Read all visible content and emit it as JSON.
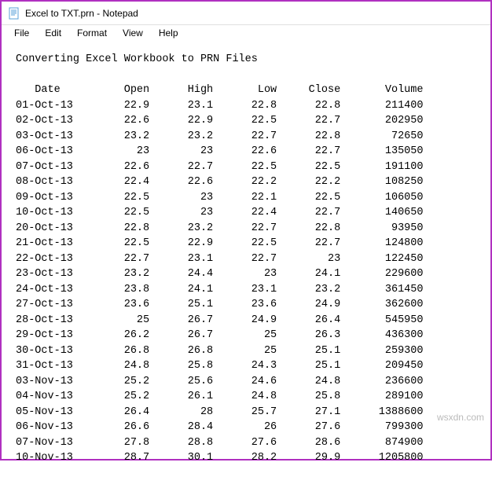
{
  "window": {
    "title": "Excel to TXT.prn - Notepad"
  },
  "menubar": {
    "items": [
      "File",
      "Edit",
      "Format",
      "View",
      "Help"
    ]
  },
  "document": {
    "heading": "Converting Excel Workbook to PRN Files",
    "columns": [
      "Date",
      "Open",
      "High",
      "Low",
      "Close",
      "Volume"
    ],
    "rows": [
      {
        "date": "01-Oct-13",
        "open": "22.9",
        "high": "23.1",
        "low": "22.8",
        "close": "22.8",
        "volume": "211400"
      },
      {
        "date": "02-Oct-13",
        "open": "22.6",
        "high": "22.9",
        "low": "22.5",
        "close": "22.7",
        "volume": "202950"
      },
      {
        "date": "03-Oct-13",
        "open": "23.2",
        "high": "23.2",
        "low": "22.7",
        "close": "22.8",
        "volume": "72650"
      },
      {
        "date": "06-Oct-13",
        "open": "23",
        "high": "23",
        "low": "22.6",
        "close": "22.7",
        "volume": "135050"
      },
      {
        "date": "07-Oct-13",
        "open": "22.6",
        "high": "22.7",
        "low": "22.5",
        "close": "22.5",
        "volume": "191100"
      },
      {
        "date": "08-Oct-13",
        "open": "22.4",
        "high": "22.6",
        "low": "22.2",
        "close": "22.2",
        "volume": "108250"
      },
      {
        "date": "09-Oct-13",
        "open": "22.5",
        "high": "23",
        "low": "22.1",
        "close": "22.5",
        "volume": "106050"
      },
      {
        "date": "10-Oct-13",
        "open": "22.5",
        "high": "23",
        "low": "22.4",
        "close": "22.7",
        "volume": "140650"
      },
      {
        "date": "20-Oct-13",
        "open": "22.8",
        "high": "23.2",
        "low": "22.7",
        "close": "22.8",
        "volume": "93950"
      },
      {
        "date": "21-Oct-13",
        "open": "22.5",
        "high": "22.9",
        "low": "22.5",
        "close": "22.7",
        "volume": "124800"
      },
      {
        "date": "22-Oct-13",
        "open": "22.7",
        "high": "23.1",
        "low": "22.7",
        "close": "23",
        "volume": "122450"
      },
      {
        "date": "23-Oct-13",
        "open": "23.2",
        "high": "24.4",
        "low": "23",
        "close": "24.1",
        "volume": "229600"
      },
      {
        "date": "24-Oct-13",
        "open": "23.8",
        "high": "24.1",
        "low": "23.1",
        "close": "23.2",
        "volume": "361450"
      },
      {
        "date": "27-Oct-13",
        "open": "23.6",
        "high": "25.1",
        "low": "23.6",
        "close": "24.9",
        "volume": "362600"
      },
      {
        "date": "28-Oct-13",
        "open": "25",
        "high": "26.7",
        "low": "24.9",
        "close": "26.4",
        "volume": "545950"
      },
      {
        "date": "29-Oct-13",
        "open": "26.2",
        "high": "26.7",
        "low": "25",
        "close": "26.3",
        "volume": "436300"
      },
      {
        "date": "30-Oct-13",
        "open": "26.8",
        "high": "26.8",
        "low": "25",
        "close": "25.1",
        "volume": "259300"
      },
      {
        "date": "31-Oct-13",
        "open": "24.8",
        "high": "25.8",
        "low": "24.3",
        "close": "25.1",
        "volume": "209450"
      },
      {
        "date": "03-Nov-13",
        "open": "25.2",
        "high": "25.6",
        "low": "24.6",
        "close": "24.8",
        "volume": "236600"
      },
      {
        "date": "04-Nov-13",
        "open": "25.2",
        "high": "26.1",
        "low": "24.8",
        "close": "25.8",
        "volume": "289100"
      },
      {
        "date": "05-Nov-13",
        "open": "26.4",
        "high": "28",
        "low": "25.7",
        "close": "27.1",
        "volume": "1388600"
      },
      {
        "date": "06-Nov-13",
        "open": "26.6",
        "high": "28.4",
        "low": "26",
        "close": "27.6",
        "volume": "799300"
      },
      {
        "date": "07-Nov-13",
        "open": "27.8",
        "high": "28.8",
        "low": "27.6",
        "close": "28.6",
        "volume": "874900"
      },
      {
        "date": "10-Nov-13",
        "open": "28.7",
        "high": "30.1",
        "low": "28.2",
        "close": "29.9",
        "volume": "1205800"
      }
    ]
  },
  "watermark": "wsxdn.com"
}
